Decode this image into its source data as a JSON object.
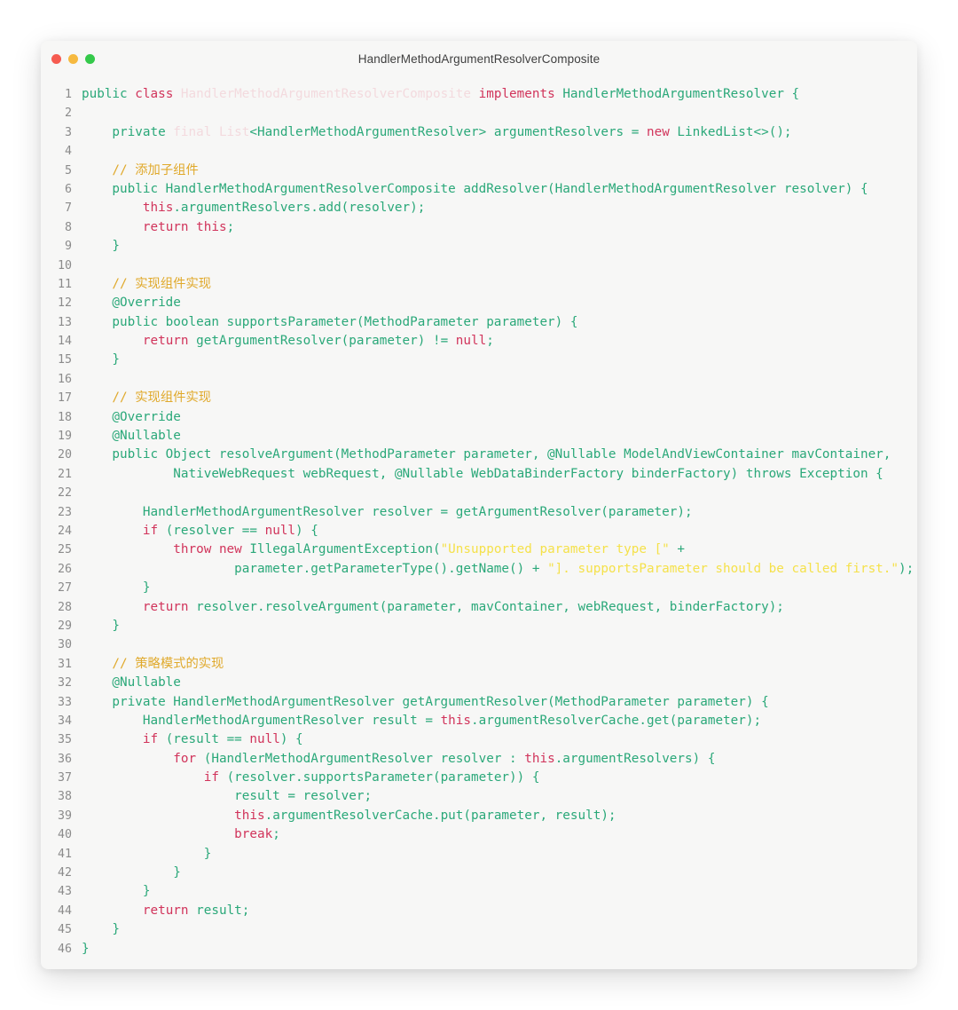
{
  "window": {
    "title": "HandlerMethodArgumentResolverComposite",
    "traffic_lights": [
      {
        "name": "close-button",
        "color": "#f65b50"
      },
      {
        "name": "minimize-button",
        "color": "#f6b93f"
      },
      {
        "name": "maximize-button",
        "color": "#34c94a"
      }
    ]
  },
  "theme": {
    "background": "#ffffff",
    "window_background": "#f7f7f6",
    "line_number_color": "#8b8b8b",
    "keyword_color": "#d1345b",
    "identifier_color": "#2aa879",
    "comment_color": "#e0a92b",
    "string_color": "#f5e14a",
    "faded_type_color": "#f3dade",
    "title_color": "#3f3f3f"
  },
  "code": {
    "language": "java",
    "first_line_number": 1,
    "last_line_number": 46,
    "lines": [
      {
        "n": "1",
        "tokens": [
          {
            "t": "public ",
            "c": "plain"
          },
          {
            "t": "class ",
            "c": "kw"
          },
          {
            "t": "HandlerMethodArgumentResolverComposite ",
            "c": "faded"
          },
          {
            "t": "implements ",
            "c": "kw"
          },
          {
            "t": "HandlerMethodArgumentResolver {",
            "c": "plain"
          }
        ]
      },
      {
        "n": "2",
        "tokens": []
      },
      {
        "n": "3",
        "tokens": [
          {
            "t": "    private ",
            "c": "plain"
          },
          {
            "t": "final ",
            "c": "faded"
          },
          {
            "t": "List",
            "c": "faded"
          },
          {
            "t": "<HandlerMethodArgumentResolver> argumentResolvers = ",
            "c": "plain"
          },
          {
            "t": "new ",
            "c": "kw"
          },
          {
            "t": "LinkedList<>();",
            "c": "plain"
          }
        ]
      },
      {
        "n": "4",
        "tokens": []
      },
      {
        "n": "5",
        "tokens": [
          {
            "t": "    // 添加子组件",
            "c": "cmt"
          }
        ]
      },
      {
        "n": "6",
        "tokens": [
          {
            "t": "    public HandlerMethodArgumentResolverComposite addResolver(HandlerMethodArgumentResolver resolver) {",
            "c": "plain"
          }
        ]
      },
      {
        "n": "7",
        "tokens": [
          {
            "t": "        ",
            "c": "plain"
          },
          {
            "t": "this",
            "c": "kw"
          },
          {
            "t": ".argumentResolvers.add(resolver);",
            "c": "plain"
          }
        ]
      },
      {
        "n": "8",
        "tokens": [
          {
            "t": "        ",
            "c": "plain"
          },
          {
            "t": "return this",
            "c": "kw"
          },
          {
            "t": ";",
            "c": "plain"
          }
        ]
      },
      {
        "n": "9",
        "tokens": [
          {
            "t": "    }",
            "c": "plain"
          }
        ]
      },
      {
        "n": "10",
        "tokens": []
      },
      {
        "n": "11",
        "tokens": [
          {
            "t": "    // 实现组件实现",
            "c": "cmt"
          }
        ]
      },
      {
        "n": "12",
        "tokens": [
          {
            "t": "    @Override",
            "c": "plain"
          }
        ]
      },
      {
        "n": "13",
        "tokens": [
          {
            "t": "    public boolean supportsParameter(MethodParameter parameter) {",
            "c": "plain"
          }
        ]
      },
      {
        "n": "14",
        "tokens": [
          {
            "t": "        ",
            "c": "plain"
          },
          {
            "t": "return ",
            "c": "kw"
          },
          {
            "t": "getArgumentResolver(parameter) != ",
            "c": "plain"
          },
          {
            "t": "null",
            "c": "kw"
          },
          {
            "t": ";",
            "c": "plain"
          }
        ]
      },
      {
        "n": "15",
        "tokens": [
          {
            "t": "    }",
            "c": "plain"
          }
        ]
      },
      {
        "n": "16",
        "tokens": []
      },
      {
        "n": "17",
        "tokens": [
          {
            "t": "    // 实现组件实现",
            "c": "cmt"
          }
        ]
      },
      {
        "n": "18",
        "tokens": [
          {
            "t": "    @Override",
            "c": "plain"
          }
        ]
      },
      {
        "n": "19",
        "tokens": [
          {
            "t": "    @Nullable",
            "c": "plain"
          }
        ]
      },
      {
        "n": "20",
        "tokens": [
          {
            "t": "    public Object resolveArgument(MethodParameter parameter, @Nullable ModelAndViewContainer mavContainer,",
            "c": "plain"
          }
        ]
      },
      {
        "n": "21",
        "tokens": [
          {
            "t": "            NativeWebRequest webRequest, @Nullable WebDataBinderFactory binderFactory) throws Exception {",
            "c": "plain"
          }
        ]
      },
      {
        "n": "22",
        "tokens": []
      },
      {
        "n": "23",
        "tokens": [
          {
            "t": "        HandlerMethodArgumentResolver resolver = getArgumentResolver(parameter);",
            "c": "plain"
          }
        ]
      },
      {
        "n": "24",
        "tokens": [
          {
            "t": "        ",
            "c": "plain"
          },
          {
            "t": "if ",
            "c": "kw"
          },
          {
            "t": "(resolver == ",
            "c": "plain"
          },
          {
            "t": "null",
            "c": "kw"
          },
          {
            "t": ") {",
            "c": "plain"
          }
        ]
      },
      {
        "n": "25",
        "tokens": [
          {
            "t": "            ",
            "c": "plain"
          },
          {
            "t": "throw new ",
            "c": "kw"
          },
          {
            "t": "IllegalArgumentException(",
            "c": "plain"
          },
          {
            "t": "\"Unsupported parameter type [\"",
            "c": "str"
          },
          {
            "t": " +",
            "c": "plain"
          }
        ]
      },
      {
        "n": "26",
        "tokens": [
          {
            "t": "                    parameter.getParameterType().getName() + ",
            "c": "plain"
          },
          {
            "t": "\"]. supportsParameter should be called first.\"",
            "c": "str"
          },
          {
            "t": ");",
            "c": "plain"
          }
        ]
      },
      {
        "n": "27",
        "tokens": [
          {
            "t": "        }",
            "c": "plain"
          }
        ]
      },
      {
        "n": "28",
        "tokens": [
          {
            "t": "        ",
            "c": "plain"
          },
          {
            "t": "return ",
            "c": "kw"
          },
          {
            "t": "resolver.resolveArgument(parameter, mavContainer, webRequest, binderFactory);",
            "c": "plain"
          }
        ]
      },
      {
        "n": "29",
        "tokens": [
          {
            "t": "    }",
            "c": "plain"
          }
        ]
      },
      {
        "n": "30",
        "tokens": []
      },
      {
        "n": "31",
        "tokens": [
          {
            "t": "    // 策略模式的实现",
            "c": "cmt"
          }
        ]
      },
      {
        "n": "32",
        "tokens": [
          {
            "t": "    @Nullable",
            "c": "plain"
          }
        ]
      },
      {
        "n": "33",
        "tokens": [
          {
            "t": "    private HandlerMethodArgumentResolver getArgumentResolver(MethodParameter parameter) {",
            "c": "plain"
          }
        ]
      },
      {
        "n": "34",
        "tokens": [
          {
            "t": "        HandlerMethodArgumentResolver result = ",
            "c": "plain"
          },
          {
            "t": "this",
            "c": "kw"
          },
          {
            "t": ".argumentResolverCache.get(parameter);",
            "c": "plain"
          }
        ]
      },
      {
        "n": "35",
        "tokens": [
          {
            "t": "        ",
            "c": "plain"
          },
          {
            "t": "if ",
            "c": "kw"
          },
          {
            "t": "(result == ",
            "c": "plain"
          },
          {
            "t": "null",
            "c": "kw"
          },
          {
            "t": ") {",
            "c": "plain"
          }
        ]
      },
      {
        "n": "36",
        "tokens": [
          {
            "t": "            ",
            "c": "plain"
          },
          {
            "t": "for ",
            "c": "kw"
          },
          {
            "t": "(HandlerMethodArgumentResolver resolver : ",
            "c": "plain"
          },
          {
            "t": "this",
            "c": "kw"
          },
          {
            "t": ".argumentResolvers) {",
            "c": "plain"
          }
        ]
      },
      {
        "n": "37",
        "tokens": [
          {
            "t": "                ",
            "c": "plain"
          },
          {
            "t": "if ",
            "c": "kw"
          },
          {
            "t": "(resolver.supportsParameter(parameter)) {",
            "c": "plain"
          }
        ]
      },
      {
        "n": "38",
        "tokens": [
          {
            "t": "                    result = resolver;",
            "c": "plain"
          }
        ]
      },
      {
        "n": "39",
        "tokens": [
          {
            "t": "                    ",
            "c": "plain"
          },
          {
            "t": "this",
            "c": "kw"
          },
          {
            "t": ".argumentResolverCache.put(parameter, result);",
            "c": "plain"
          }
        ]
      },
      {
        "n": "40",
        "tokens": [
          {
            "t": "                    ",
            "c": "plain"
          },
          {
            "t": "break",
            "c": "kw"
          },
          {
            "t": ";",
            "c": "plain"
          }
        ]
      },
      {
        "n": "41",
        "tokens": [
          {
            "t": "                }",
            "c": "plain"
          }
        ]
      },
      {
        "n": "42",
        "tokens": [
          {
            "t": "            }",
            "c": "plain"
          }
        ]
      },
      {
        "n": "43",
        "tokens": [
          {
            "t": "        }",
            "c": "plain"
          }
        ]
      },
      {
        "n": "44",
        "tokens": [
          {
            "t": "        ",
            "c": "plain"
          },
          {
            "t": "return ",
            "c": "kw"
          },
          {
            "t": "result;",
            "c": "plain"
          }
        ]
      },
      {
        "n": "45",
        "tokens": [
          {
            "t": "    }",
            "c": "plain"
          }
        ]
      },
      {
        "n": "46",
        "tokens": [
          {
            "t": "}",
            "c": "plain"
          }
        ]
      }
    ]
  }
}
